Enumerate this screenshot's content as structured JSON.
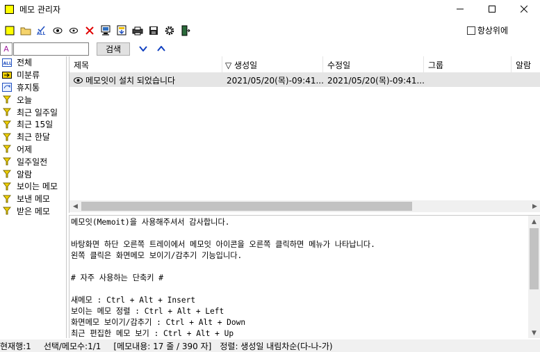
{
  "window": {
    "title": "메모 관리자",
    "controls": {
      "minimize": "─",
      "maximize": "☐",
      "close": "✕"
    }
  },
  "toolbar": {
    "buttons": [
      {
        "name": "new-memo-icon"
      },
      {
        "name": "open-folder-icon"
      },
      {
        "name": "check-all-icon"
      },
      {
        "name": "show-icon"
      },
      {
        "name": "show-alt-icon"
      },
      {
        "name": "delete-icon"
      },
      {
        "name": "export-icon"
      },
      {
        "name": "import-icon"
      },
      {
        "name": "print-icon"
      },
      {
        "name": "save-icon"
      },
      {
        "name": "settings-icon"
      },
      {
        "name": "exit-icon"
      }
    ],
    "always_on_top_label": "항상위에"
  },
  "search": {
    "font_button": "A",
    "input_value": "",
    "button_label": "검색",
    "down_arrow": "∨",
    "up_arrow": "∧"
  },
  "sidebar": {
    "items": [
      {
        "label": "전체",
        "icon": "all-icon"
      },
      {
        "label": "미분류",
        "icon": "arrow-folder-icon"
      },
      {
        "label": "휴지통",
        "icon": "trash-icon"
      },
      {
        "label": "오늘",
        "icon": "filter-icon"
      },
      {
        "label": "최근 일주일",
        "icon": "filter-icon"
      },
      {
        "label": "최근 15일",
        "icon": "filter-icon"
      },
      {
        "label": "최근 한달",
        "icon": "filter-icon"
      },
      {
        "label": "어제",
        "icon": "filter-icon"
      },
      {
        "label": "일주일전",
        "icon": "filter-icon"
      },
      {
        "label": "알람",
        "icon": "filter-icon"
      },
      {
        "label": "보이는 메모",
        "icon": "filter-icon"
      },
      {
        "label": "보낸 메모",
        "icon": "filter-icon"
      },
      {
        "label": "받은 메모",
        "icon": "filter-icon"
      }
    ]
  },
  "list": {
    "columns": [
      {
        "label": "제목"
      },
      {
        "label": "▽  생성일"
      },
      {
        "label": "수정일"
      },
      {
        "label": "그룹"
      },
      {
        "label": "알람"
      }
    ],
    "rows": [
      {
        "title": "메모잇이 설치 되었습니다",
        "created": "2021/05/20(목)-09:41...",
        "modified": "2021/05/20(목)-09:41...",
        "group": "",
        "alarm": ""
      }
    ]
  },
  "content": {
    "text": "메모잇(Memoit)을 사용해주셔서 감사합니다.\n\n바탕화면 하단 오른쪽 트레이에서 메모잇 아이콘을 오른쪽 클릭하면 메뉴가 나타납니다.\n왼쪽 클릭은 화면메모 보이기/감추기 기능입니다.\n\n# 자주 사용하는 단축키 #\n\n새메모 : Ctrl + Alt + Insert\n보이는 메모 정렬 : Ctrl + Alt + Left\n화면메모 보이기/감추기 : Ctrl + Alt + Down\n최근 편집한 메모 보기 : Ctrl + Alt + Up"
  },
  "status": {
    "current_row": "현재행:1",
    "selection": "선택/메모수:1/1",
    "memo_info": "[메모내용: 17 줄 / 390 자]",
    "sort": "정렬: 생성일 내림차순(다-나-가)"
  }
}
